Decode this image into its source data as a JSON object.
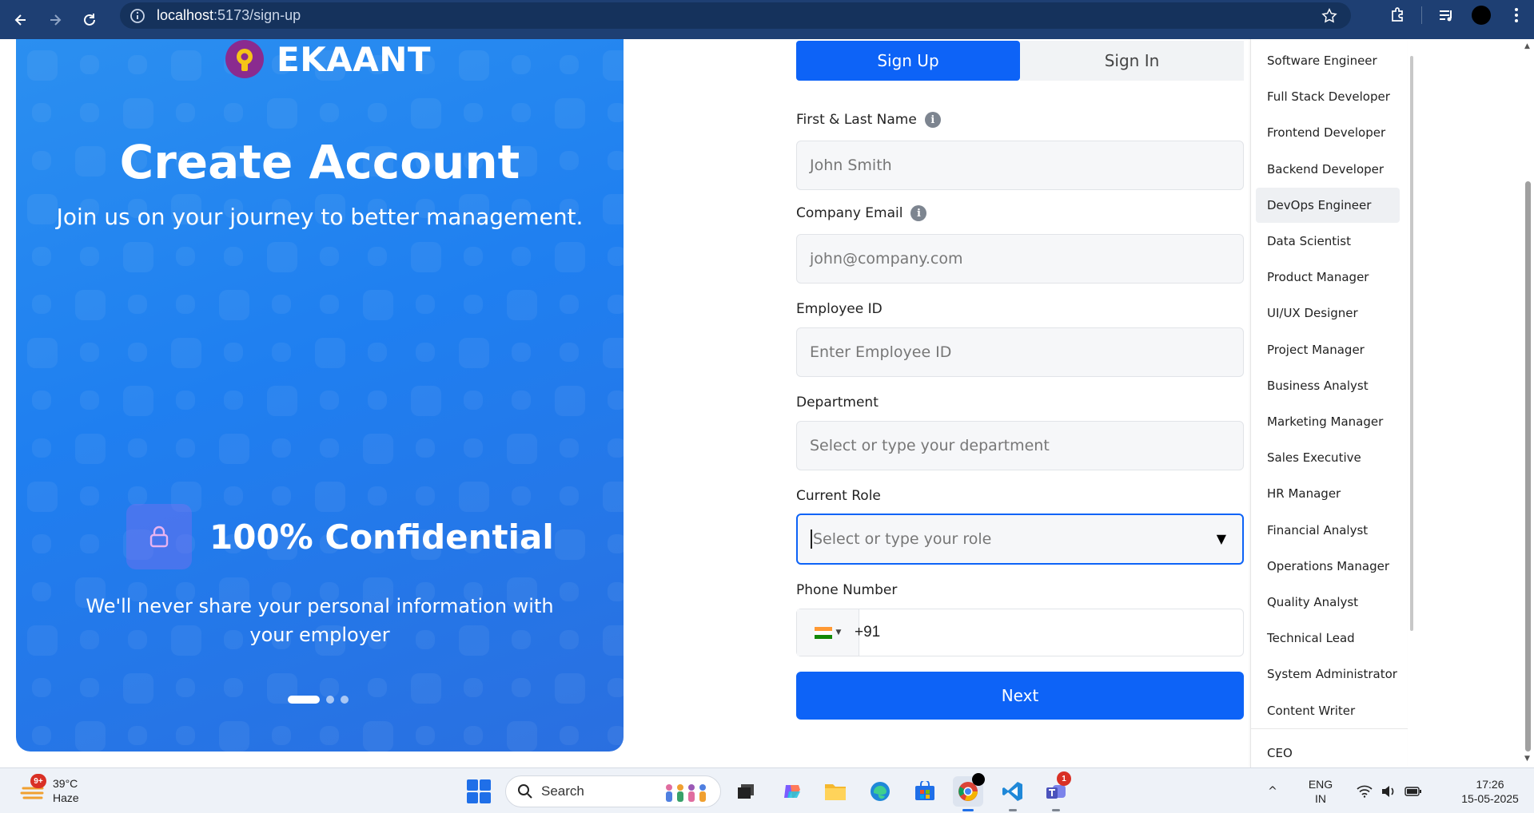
{
  "browser": {
    "url_host": "localhost",
    "url_rest": ":5173/sign-up",
    "icons": [
      "back-arrow-icon",
      "forward-arrow-icon",
      "reload-icon",
      "info-icon",
      "star-icon",
      "extensions-icon",
      "media-icon",
      "profile-avatar",
      "menu-icon"
    ]
  },
  "hero": {
    "brand": "EKAANT",
    "title": "Create Account",
    "subtitle": "Join us on your journey to better management.",
    "feature_title": "100% Confidential",
    "feature_desc": "We'll never share your personal information with your employer",
    "carousel": {
      "count": 3,
      "active": 0
    },
    "colors": {
      "gradient_start": "#2b8ff0",
      "gradient_end": "#2a6fe0",
      "logo": "#8a2b8f"
    }
  },
  "tabs": {
    "sign_up": "Sign Up",
    "sign_in": "Sign In",
    "active": "sign_up"
  },
  "form": {
    "name_label": "First & Last Name",
    "name_placeholder": "John Smith",
    "email_label": "Company Email",
    "email_placeholder": "john@company.com",
    "employee_label": "Employee ID",
    "employee_placeholder": "Enter Employee ID",
    "department_label": "Department",
    "department_placeholder": "Select or type your department",
    "role_label": "Current Role",
    "role_placeholder": "Select or type your role",
    "phone_label": "Phone Number",
    "phone_code": "+91",
    "next_label": "Next",
    "accent": "#0d63f7"
  },
  "role_options": [
    "Software Engineer",
    "Full Stack Developer",
    "Frontend Developer",
    "Backend Developer",
    "DevOps Engineer",
    "Data Scientist",
    "Product Manager",
    "UI/UX Designer",
    "Project Manager",
    "Business Analyst",
    "Marketing Manager",
    "Sales Executive",
    "HR Manager",
    "Financial Analyst",
    "Operations Manager",
    "Quality Analyst",
    "Technical Lead",
    "System Administrator",
    "Content Writer"
  ],
  "role_hovered": "DevOps Engineer",
  "role_extra": "CEO",
  "taskbar": {
    "weather_temp": "39°C",
    "weather_desc": "Haze",
    "weather_badge": "9+",
    "search_label": "Search",
    "lang_1": "ENG",
    "lang_2": "IN",
    "time": "17:26",
    "date": "15-05-2025",
    "teams_badge": "1"
  }
}
